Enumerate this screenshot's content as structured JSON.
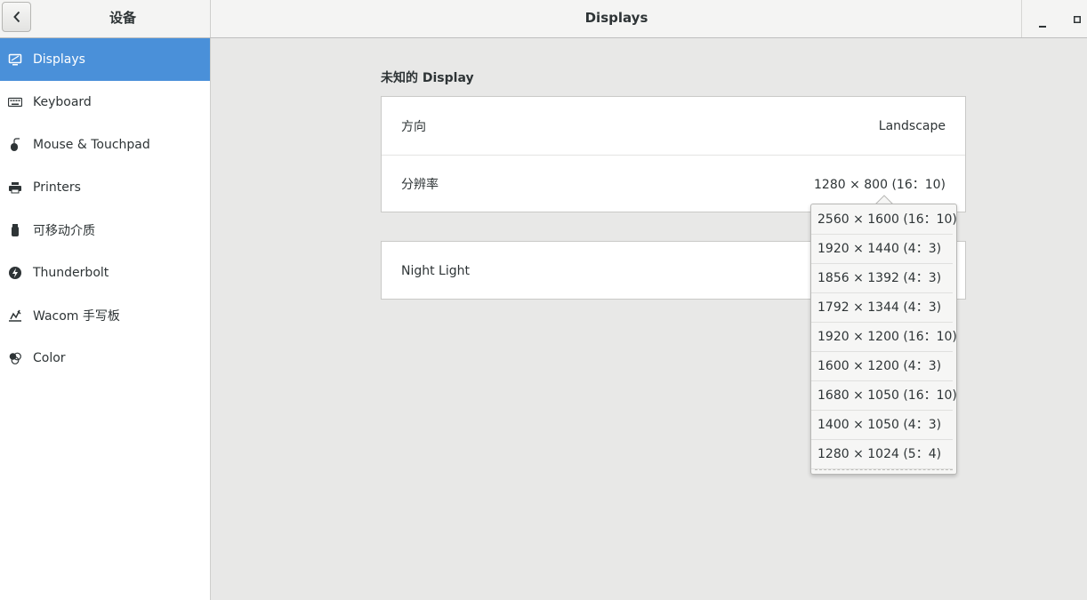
{
  "header": {
    "sidebar_title": "设备",
    "main_title": "Displays"
  },
  "sidebar": {
    "items": [
      {
        "label": "Displays",
        "icon": "display-icon",
        "active": true
      },
      {
        "label": "Keyboard",
        "icon": "keyboard-icon",
        "active": false
      },
      {
        "label": "Mouse & Touchpad",
        "icon": "mouse-icon",
        "active": false
      },
      {
        "label": "Printers",
        "icon": "printer-icon",
        "active": false
      },
      {
        "label": "可移动介质",
        "icon": "removable-media-icon",
        "active": false
      },
      {
        "label": "Thunderbolt",
        "icon": "thunderbolt-icon",
        "active": false
      },
      {
        "label": "Wacom 手写板",
        "icon": "tablet-icon",
        "active": false
      },
      {
        "label": "Color",
        "icon": "color-icon",
        "active": false
      }
    ]
  },
  "main": {
    "display_title": "未知的  Display",
    "orientation_label": "方向",
    "orientation_value": "Landscape",
    "resolution_label": "分辨率",
    "resolution_value": "1280 × 800 (16：10)",
    "night_light_label": "Night Light"
  },
  "resolution_popover": {
    "options": [
      "2560 × 1600 (16：10)",
      "1920 × 1440 (4：3)",
      "1856 × 1392 (4：3)",
      "1792 × 1344 (4：3)",
      "1920 × 1200 (16：10)",
      "1600 × 1200 (4：3)",
      "1680 × 1050 (16：10)",
      "1400 × 1050 (4：3)",
      "1280 × 1024 (5：4)"
    ]
  },
  "colors": {
    "accent": "#4a90d9",
    "background": "#e8e8e7",
    "header": "#f4f4f3"
  }
}
